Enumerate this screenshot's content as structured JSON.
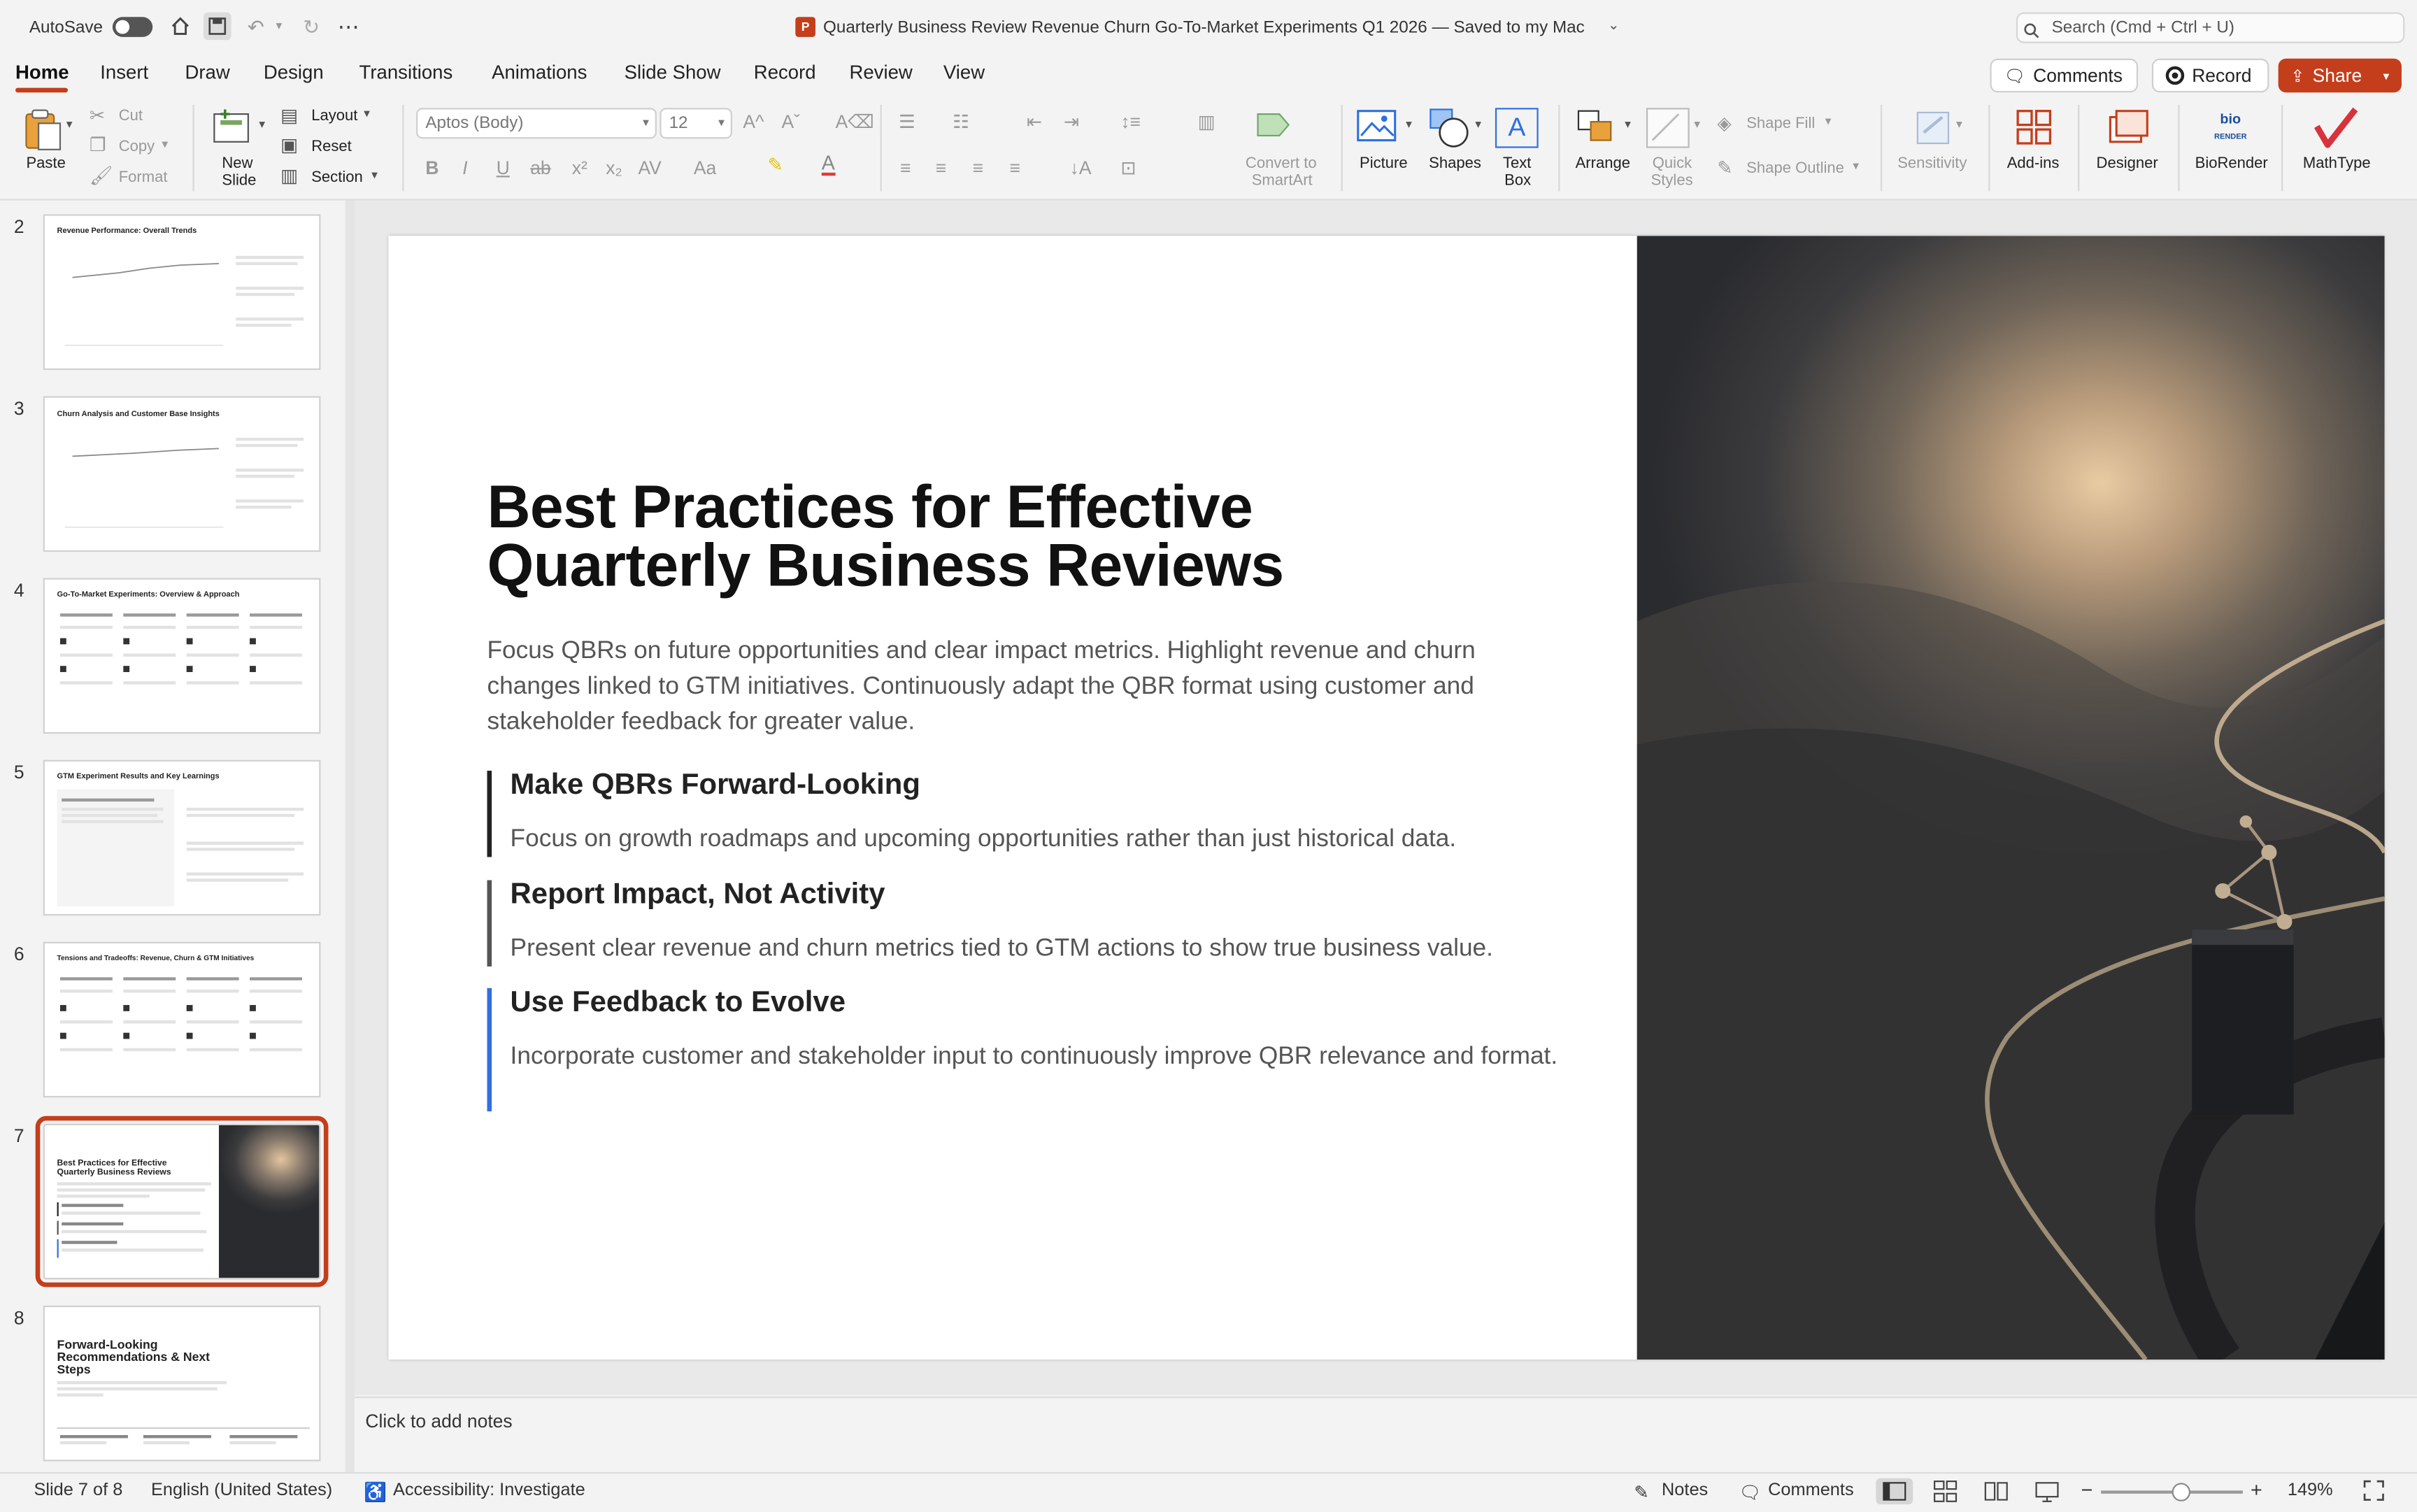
{
  "titlebar": {
    "autosave_label": "AutoSave",
    "doc_title": "Quarterly Business Review Revenue Churn Go-To-Market Experiments Q1 2026 — Saved to my Mac",
    "search_placeholder": "Search (Cmd + Ctrl + U)"
  },
  "tabs": [
    "Home",
    "Insert",
    "Draw",
    "Design",
    "Transitions",
    "Animations",
    "Slide Show",
    "Record",
    "Review",
    "View"
  ],
  "top_buttons": {
    "comments": "Comments",
    "record": "Record",
    "share": "Share"
  },
  "ribbon": {
    "paste": "Paste",
    "cut": "Cut",
    "copy": "Copy",
    "format": "Format",
    "new_slide_1": "New",
    "new_slide_2": "Slide",
    "layout": "Layout",
    "reset": "Reset",
    "section": "Section",
    "font_name": "Aptos (Body)",
    "font_size": "12",
    "convert_1": "Convert to",
    "convert_2": "SmartArt",
    "picture": "Picture",
    "shapes": "Shapes",
    "textbox_1": "Text",
    "textbox_2": "Box",
    "arrange": "Arrange",
    "quick_1": "Quick",
    "quick_2": "Styles",
    "shape_fill": "Shape Fill",
    "shape_outline": "Shape Outline",
    "sensitivity": "Sensitivity",
    "addins": "Add-ins",
    "designer": "Designer",
    "biorender": "BioRender",
    "mathtype": "MathType"
  },
  "thumbnails": [
    {
      "num": "2",
      "title": "Revenue Performance: Overall Trends"
    },
    {
      "num": "3",
      "title": "Churn Analysis and Customer Base Insights"
    },
    {
      "num": "4",
      "title": "Go-To-Market Experiments: Overview & Approach"
    },
    {
      "num": "5",
      "title": "GTM Experiment Results and Key Learnings"
    },
    {
      "num": "6",
      "title": "Tensions and Tradeoffs: Revenue, Churn & GTM Initiatives"
    },
    {
      "num": "7",
      "title_1": "Best Practices for Effective",
      "title_2": "Quarterly Business Reviews"
    },
    {
      "num": "8",
      "title_1": "Forward-Looking",
      "title_2": "Recommendations & Next",
      "title_3": "Steps"
    }
  ],
  "slide": {
    "title_line1": "Best Practices for Effective",
    "title_line2": "Quarterly Business Reviews",
    "intro": "Focus QBRs on future opportunities and clear impact metrics. Highlight revenue and churn changes linked to GTM initiatives. Continuously adapt the QBR format using customer and stakeholder feedback for greater value.",
    "points": [
      {
        "heading": "Make QBRs Forward-Looking",
        "text": "Focus on growth roadmaps and upcoming opportunities rather than just historical data.",
        "bar_color": "#222222"
      },
      {
        "heading": "Report Impact, Not Activity",
        "text": "Present clear revenue and churn metrics tied to GTM actions to show true business value.",
        "bar_color": "#555555"
      },
      {
        "heading": "Use Feedback to Evolve",
        "text": "Incorporate customer and stakeholder input to continuously improve QBR relevance and format.",
        "bar_color": "#2f6fe0"
      }
    ]
  },
  "notes_placeholder": "Click to add notes",
  "status": {
    "slide_count": "Slide 7 of 8",
    "language": "English (United States)",
    "accessibility": "Accessibility: Investigate",
    "notes": "Notes",
    "comments": "Comments",
    "zoom": "149%"
  },
  "colors": {
    "accent": "#c43e1c",
    "blue_bar": "#2f6fe0"
  }
}
